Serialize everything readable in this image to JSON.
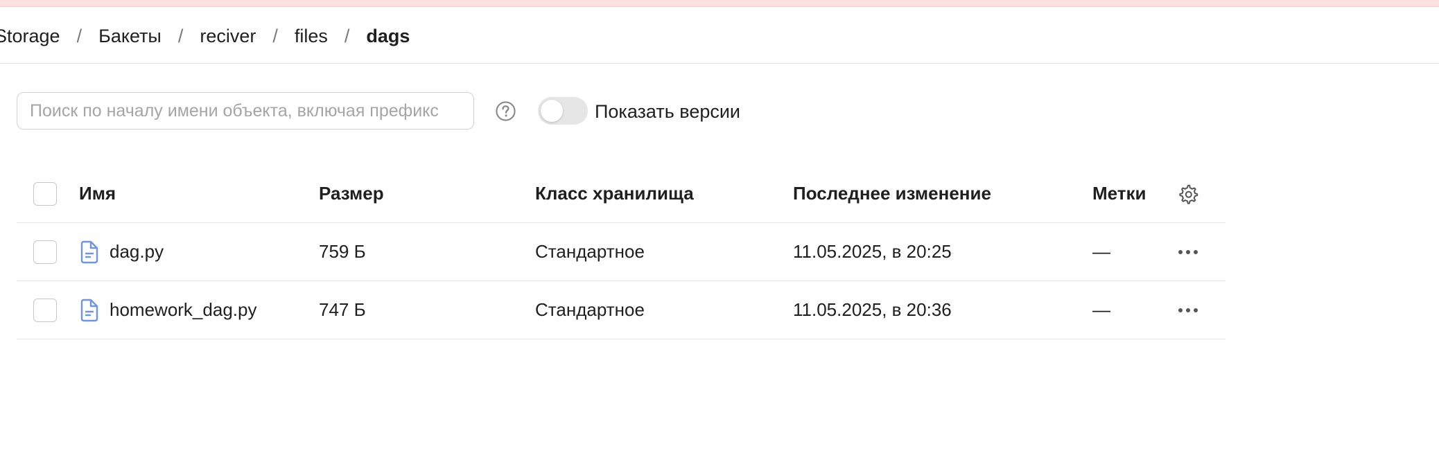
{
  "colors": {
    "top_strip": "#fde2df",
    "file_icon": "#6f93e8",
    "toggle_off": "#e6e6e6",
    "muted_text": "#a5a5a5"
  },
  "breadcrumb": {
    "items": [
      "Storage",
      "Бакеты",
      "reciver",
      "files",
      "dags"
    ],
    "separator": "/"
  },
  "toolbar": {
    "search_placeholder": "Поиск по началу имени объекта, включая префикс",
    "search_value": "",
    "help_icon": "question-circle-icon",
    "show_versions_label": "Показать версии",
    "show_versions_on": false
  },
  "table": {
    "columns": {
      "name": "Имя",
      "size": "Размер",
      "storage_class": "Класс хранилища",
      "modified": "Последнее изменение",
      "tags": "Метки"
    },
    "settings_icon": "gear-icon",
    "rows": [
      {
        "name": "dag.py",
        "size": "759 Б",
        "storage_class": "Стандартное",
        "modified": "11.05.2025, в 20:25",
        "tags": "—",
        "icon": "file-icon",
        "action_icon": "more-icon"
      },
      {
        "name": "homework_dag.py",
        "size": "747 Б",
        "storage_class": "Стандартное",
        "modified": "11.05.2025, в 20:36",
        "tags": "—",
        "icon": "file-icon",
        "action_icon": "more-icon"
      }
    ]
  }
}
